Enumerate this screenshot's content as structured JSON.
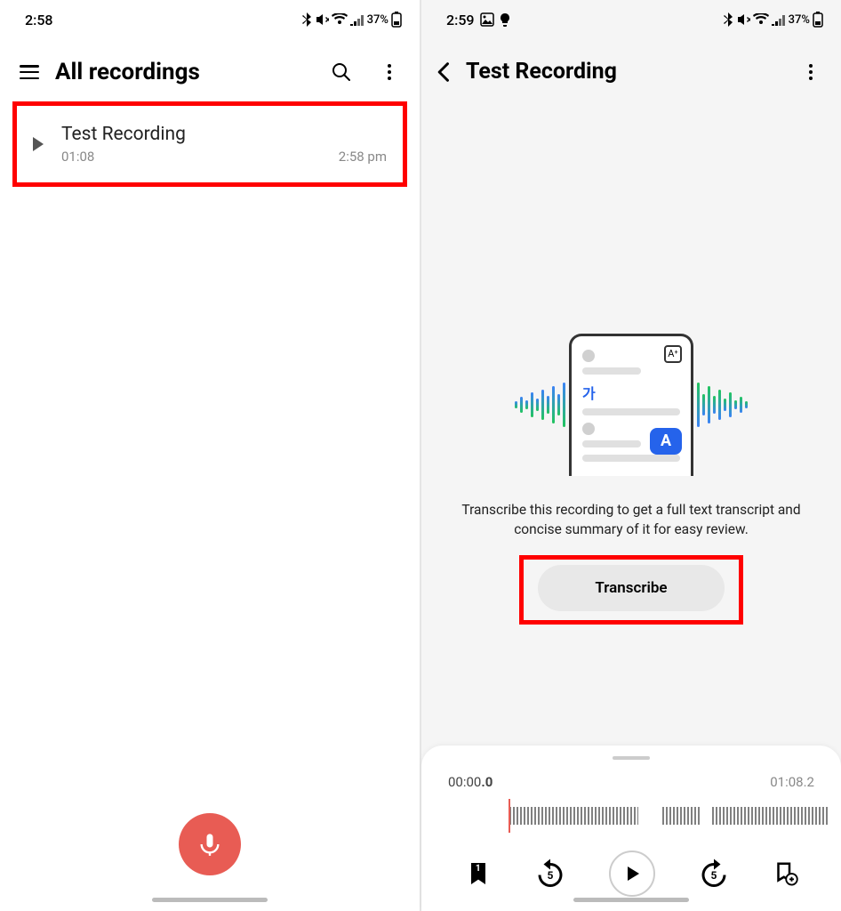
{
  "left": {
    "status": {
      "time": "2:58",
      "battery": "37%"
    },
    "header": {
      "title": "All recordings"
    },
    "recording": {
      "title": "Test Recording",
      "duration": "01:08",
      "time": "2:58 pm"
    }
  },
  "right": {
    "status": {
      "time": "2:59",
      "battery": "37%"
    },
    "header": {
      "title": "Test Recording"
    },
    "illus": {
      "ga": "가",
      "a": "A"
    },
    "description": "Transcribe this recording to get a full text transcript and concise summary of it for easy review.",
    "transcribe_label": "Transcribe",
    "player": {
      "current_prefix": "00:00",
      "current_suffix": ".0",
      "total": "01:08.2",
      "bookmark_badge": "1",
      "rewind_secs": "5",
      "forward_secs": "5"
    }
  }
}
